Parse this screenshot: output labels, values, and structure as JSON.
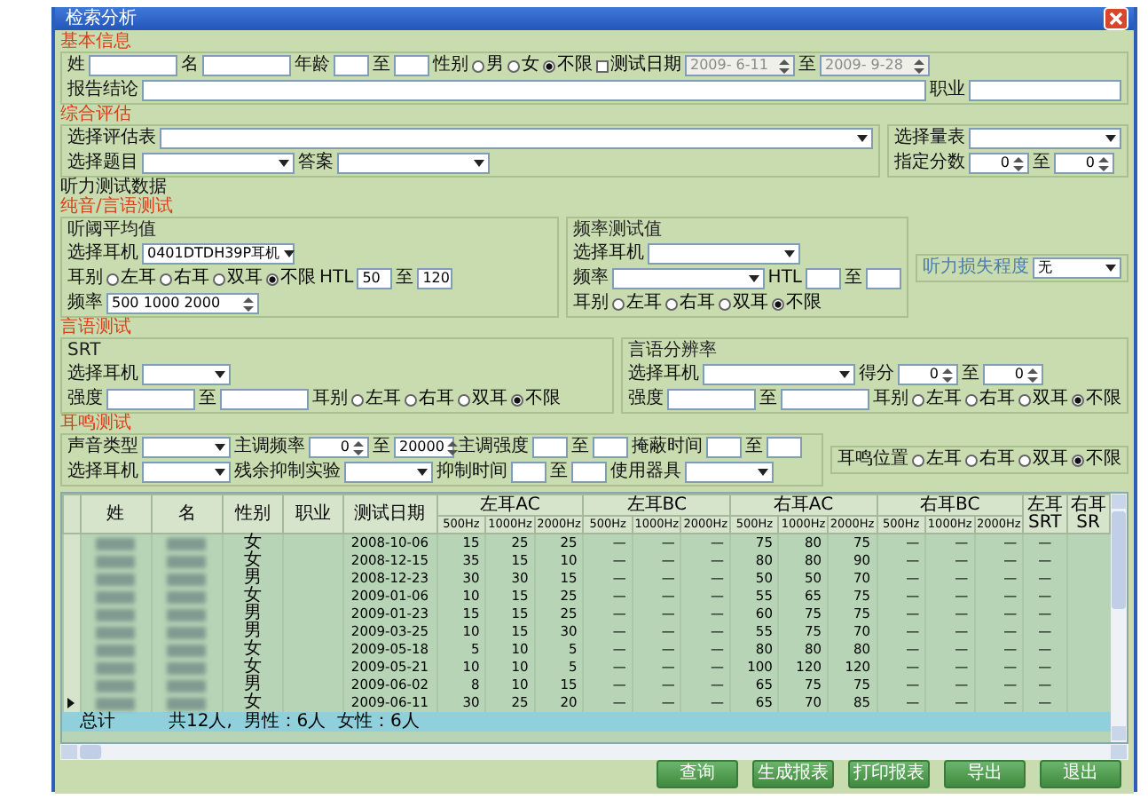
{
  "window": {
    "title": "检索分析"
  },
  "sections": [
    {
      "title": "基本信息",
      "groups": [
        {
          "lines": [
            {
              "items": [
                {
                  "kind": "label",
                  "text": "姓"
                },
                {
                  "kind": "input"
                },
                {
                  "kind": "label",
                  "text": "名"
                },
                {
                  "kind": "input"
                },
                {
                  "kind": "label",
                  "text": "年龄"
                },
                {
                  "kind": "short-input"
                },
                {
                  "kind": "label",
                  "text": "至"
                },
                {
                  "kind": "short-input"
                },
                {
                  "kind": "label",
                  "text": "性别"
                },
                {
                  "kind": "radio",
                  "text": "男",
                  "selected": false
                },
                {
                  "kind": "radio",
                  "text": "女",
                  "selected": false
                },
                {
                  "kind": "radio",
                  "text": "不限",
                  "selected": true
                },
                {
                  "kind": "checkbox",
                  "text": "测试日期",
                  "checked": false
                },
                {
                  "kind": "date",
                  "value": "2009- 6-11",
                  "disabled": true
                },
                {
                  "kind": "label",
                  "text": "至"
                },
                {
                  "kind": "date",
                  "value": "2009- 9-28",
                  "disabled": true
                }
              ]
            },
            {
              "items": [
                {
                  "kind": "label",
                  "text": "报告结论"
                },
                {
                  "kind": "wide-input"
                },
                {
                  "kind": "label",
                  "text": "职业"
                },
                {
                  "kind": "long-input"
                }
              ]
            }
          ]
        }
      ]
    },
    {
      "title": "综合评估",
      "groups": [
        {
          "lines": [
            {
              "items": [
                {
                  "kind": "label",
                  "text": "选择评估表"
                },
                {
                  "kind": "wide-select"
                }
              ]
            },
            {
              "items": [
                {
                  "kind": "label",
                  "text": "选择题目"
                },
                {
                  "kind": "long-select"
                },
                {
                  "kind": "label",
                  "text": "答案"
                },
                {
                  "kind": "long-select"
                }
              ]
            }
          ]
        },
        {
          "lines": [
            {
              "items": [
                {
                  "kind": "label",
                  "text": "选择量表"
                },
                {
                  "kind": "long-select"
                }
              ]
            },
            {
              "items": [
                {
                  "kind": "label",
                  "text": "指定分数"
                },
                {
                  "kind": "spin",
                  "value": "0"
                },
                {
                  "kind": "label",
                  "text": "至"
                },
                {
                  "kind": "spin",
                  "value": "0"
                }
              ]
            }
          ]
        }
      ]
    },
    {
      "title": "听力测试数据"
    },
    {
      "title": "纯音/言语测试",
      "groups": [
        {
          "title": "听阈平均值",
          "lines": [
            {
              "items": [
                {
                  "kind": "label",
                  "text": "选择耳机"
                },
                {
                  "kind": "long-select",
                  "value": "0401DTDH39P耳机"
                }
              ]
            },
            {
              "items": [
                {
                  "kind": "label",
                  "text": "耳别"
                },
                {
                  "kind": "radio",
                  "text": "左耳",
                  "selected": false
                },
                {
                  "kind": "radio",
                  "text": "右耳",
                  "selected": false
                },
                {
                  "kind": "radio",
                  "text": "双耳",
                  "selected": false
                },
                {
                  "kind": "radio",
                  "text": "不限",
                  "selected": true
                },
                {
                  "kind": "label",
                  "text": "HTL"
                },
                {
                  "kind": "short-input",
                  "value": "50"
                },
                {
                  "kind": "label",
                  "text": "至"
                },
                {
                  "kind": "short-input",
                  "value": "120"
                }
              ]
            },
            {
              "items": [
                {
                  "kind": "label",
                  "text": "频率"
                },
                {
                  "kind": "long-spin",
                  "value": "500 1000 2000"
                }
              ]
            }
          ]
        },
        {
          "title": "频率测试值",
          "lines": [
            {
              "items": [
                {
                  "kind": "label",
                  "text": "选择耳机"
                },
                {
                  "kind": "long-select"
                }
              ]
            },
            {
              "items": [
                {
                  "kind": "label",
                  "text": "频率"
                },
                {
                  "kind": "long-select"
                },
                {
                  "kind": "label",
                  "text": "HTL"
                },
                {
                  "kind": "short-input"
                },
                {
                  "kind": "label",
                  "text": "至"
                },
                {
                  "kind": "short-input"
                }
              ]
            },
            {
              "items": [
                {
                  "kind": "label",
                  "text": "耳别"
                },
                {
                  "kind": "radio",
                  "text": "左耳",
                  "selected": false
                },
                {
                  "kind": "radio",
                  "text": "右耳",
                  "selected": false
                },
                {
                  "kind": "radio",
                  "text": "双耳",
                  "selected": false
                },
                {
                  "kind": "radio",
                  "text": "不限",
                  "selected": true
                }
              ]
            }
          ]
        },
        {
          "lines": [
            {
              "items": [
                {
                  "kind": "hint",
                  "text": "听力损失程度"
                },
                {
                  "kind": "select",
                  "value": "无"
                }
              ]
            }
          ]
        }
      ]
    },
    {
      "title": "言语测试",
      "groups": [
        {
          "title": "SRT",
          "lines": [
            {
              "items": [
                {
                  "kind": "label",
                  "text": "选择耳机"
                },
                {
                  "kind": "select"
                }
              ]
            },
            {
              "items": [
                {
                  "kind": "label",
                  "text": "强度"
                },
                {
                  "kind": "input"
                },
                {
                  "kind": "label",
                  "text": "至"
                },
                {
                  "kind": "input"
                },
                {
                  "kind": "label",
                  "text": "耳别"
                },
                {
                  "kind": "radio",
                  "text": "左耳",
                  "selected": false
                },
                {
                  "kind": "radio",
                  "text": "右耳",
                  "selected": false
                },
                {
                  "kind": "radio",
                  "text": "双耳",
                  "selected": false
                },
                {
                  "kind": "radio",
                  "text": "不限",
                  "selected": true
                }
              ]
            }
          ]
        },
        {
          "title": "言语分辨率",
          "lines": [
            {
              "items": [
                {
                  "kind": "label",
                  "text": "选择耳机"
                },
                {
                  "kind": "long-select"
                },
                {
                  "kind": "label",
                  "text": "得分"
                },
                {
                  "kind": "spin",
                  "value": "0"
                },
                {
                  "kind": "label",
                  "text": "至"
                },
                {
                  "kind": "spin",
                  "value": "0"
                }
              ]
            },
            {
              "items": [
                {
                  "kind": "label",
                  "text": "强度"
                },
                {
                  "kind": "input"
                },
                {
                  "kind": "label",
                  "text": "至"
                },
                {
                  "kind": "input"
                },
                {
                  "kind": "label",
                  "text": "耳别"
                },
                {
                  "kind": "radio",
                  "text": "左耳",
                  "selected": false
                },
                {
                  "kind": "radio",
                  "text": "右耳",
                  "selected": false
                },
                {
                  "kind": "radio",
                  "text": "双耳",
                  "selected": false
                },
                {
                  "kind": "radio",
                  "text": "不限",
                  "selected": true
                }
              ]
            }
          ]
        }
      ]
    },
    {
      "title": "耳鸣测试",
      "groups": [
        {
          "lines": [
            {
              "items": [
                {
                  "kind": "label",
                  "text": "声音类型"
                },
                {
                  "kind": "select"
                },
                {
                  "kind": "label",
                  "text": "主调频率"
                },
                {
                  "kind": "spin",
                  "value": "0"
                },
                {
                  "kind": "label",
                  "text": "至"
                },
                {
                  "kind": "spin",
                  "value": "20000"
                },
                {
                  "kind": "label",
                  "text": "主调强度"
                },
                {
                  "kind": "short-input"
                },
                {
                  "kind": "label",
                  "text": "至"
                },
                {
                  "kind": "short-input"
                },
                {
                  "kind": "label",
                  "text": "掩蔽时间"
                },
                {
                  "kind": "short-input"
                },
                {
                  "kind": "label",
                  "text": "至"
                },
                {
                  "kind": "short-input"
                }
              ]
            },
            {
              "items": [
                {
                  "kind": "label",
                  "text": "选择耳机"
                },
                {
                  "kind": "select"
                },
                {
                  "kind": "label",
                  "text": "残余抑制实验"
                },
                {
                  "kind": "select"
                },
                {
                  "kind": "label",
                  "text": "抑制时间"
                },
                {
                  "kind": "short-input"
                },
                {
                  "kind": "label",
                  "text": "至"
                },
                {
                  "kind": "short-input"
                },
                {
                  "kind": "label",
                  "text": "使用器具"
                },
                {
                  "kind": "select"
                }
              ]
            }
          ]
        },
        {
          "lines": [
            {
              "items": [
                {
                  "kind": "label",
                  "text": "耳鸣位置"
                },
                {
                  "kind": "radio",
                  "text": "左耳",
                  "selected": false
                },
                {
                  "kind": "radio",
                  "text": "右耳",
                  "selected": false
                },
                {
                  "kind": "radio",
                  "text": "双耳",
                  "selected": false
                },
                {
                  "kind": "radio",
                  "text": "不限",
                  "selected": true
                }
              ]
            }
          ]
        }
      ]
    }
  ],
  "table": {
    "columns": [
      {
        "label": "姓",
        "kind": "blurred"
      },
      {
        "label": "名",
        "kind": "blurred"
      },
      {
        "label": "性别"
      },
      {
        "label": "职业"
      },
      {
        "label": "测试日期"
      },
      {
        "label": "左耳AC",
        "colspan": 3,
        "sub": [
          "500Hz",
          "1000Hz",
          "2000Hz"
        ]
      },
      {
        "label": "左耳BC",
        "colspan": 3,
        "sub": [
          "500Hz",
          "1000Hz",
          "2000Hz"
        ]
      },
      {
        "label": "右耳AC",
        "colspan": 3,
        "sub": [
          "500Hz",
          "1000Hz",
          "2000Hz"
        ]
      },
      {
        "label": "右耳BC",
        "colspan": 3,
        "sub": [
          "500Hz",
          "1000Hz",
          "2000Hz"
        ]
      },
      {
        "label": "左耳SRT"
      },
      {
        "label": "右耳SR"
      }
    ],
    "rows": [
      {
        "current": false,
        "cells": [
          null,
          null,
          "女",
          null,
          "2008-10-06",
          "15",
          "25",
          "25",
          "—",
          "—",
          "—",
          "75",
          "80",
          "75",
          "—",
          "—",
          "—",
          "—",
          null
        ]
      },
      {
        "current": false,
        "cells": [
          null,
          null,
          "女",
          null,
          "2008-12-15",
          "35",
          "15",
          "10",
          "—",
          "—",
          "—",
          "80",
          "80",
          "90",
          "—",
          "—",
          "—",
          "—",
          null
        ]
      },
      {
        "current": false,
        "cells": [
          null,
          null,
          "男",
          null,
          "2008-12-23",
          "30",
          "30",
          "15",
          "—",
          "—",
          "—",
          "50",
          "50",
          "70",
          "—",
          "—",
          "—",
          "—",
          null
        ]
      },
      {
        "current": false,
        "cells": [
          null,
          null,
          "女",
          null,
          "2009-01-06",
          "10",
          "15",
          "25",
          "—",
          "—",
          "—",
          "55",
          "65",
          "75",
          "—",
          "—",
          "—",
          "—",
          null
        ]
      },
      {
        "current": false,
        "cells": [
          null,
          null,
          "男",
          null,
          "2009-01-23",
          "15",
          "15",
          "25",
          "—",
          "—",
          "—",
          "60",
          "75",
          "75",
          "—",
          "—",
          "—",
          "—",
          null
        ]
      },
      {
        "current": false,
        "cells": [
          null,
          null,
          "男",
          null,
          "2009-03-25",
          "10",
          "15",
          "30",
          "—",
          "—",
          "—",
          "55",
          "75",
          "70",
          "—",
          "—",
          "—",
          "—",
          null
        ]
      },
      {
        "current": false,
        "cells": [
          null,
          null,
          "女",
          null,
          "2009-05-18",
          "5",
          "10",
          "5",
          "—",
          "—",
          "—",
          "80",
          "80",
          "80",
          "—",
          "—",
          "—",
          "—",
          null
        ]
      },
      {
        "current": false,
        "cells": [
          null,
          null,
          "女",
          null,
          "2009-05-21",
          "10",
          "10",
          "5",
          "—",
          "—",
          "—",
          "100",
          "120",
          "120",
          "—",
          "—",
          "—",
          "—",
          null
        ]
      },
      {
        "current": false,
        "cells": [
          null,
          null,
          "男",
          null,
          "2009-06-02",
          "8",
          "10",
          "15",
          "—",
          "—",
          "—",
          "65",
          "75",
          "75",
          "—",
          "—",
          "—",
          "—",
          null
        ]
      },
      {
        "current": true,
        "cells": [
          null,
          null,
          "女",
          null,
          "2009-06-11",
          "30",
          "25",
          "20",
          "—",
          "—",
          "—",
          "65",
          "70",
          "85",
          "—",
          "—",
          "—",
          "—",
          null
        ]
      }
    ],
    "total": {
      "label": "总计",
      "summary": "共12人,  男性：6人  女性：6人"
    }
  },
  "buttons": [
    "查询",
    "生成报表",
    "打印报表",
    "导出",
    "退出"
  ]
}
